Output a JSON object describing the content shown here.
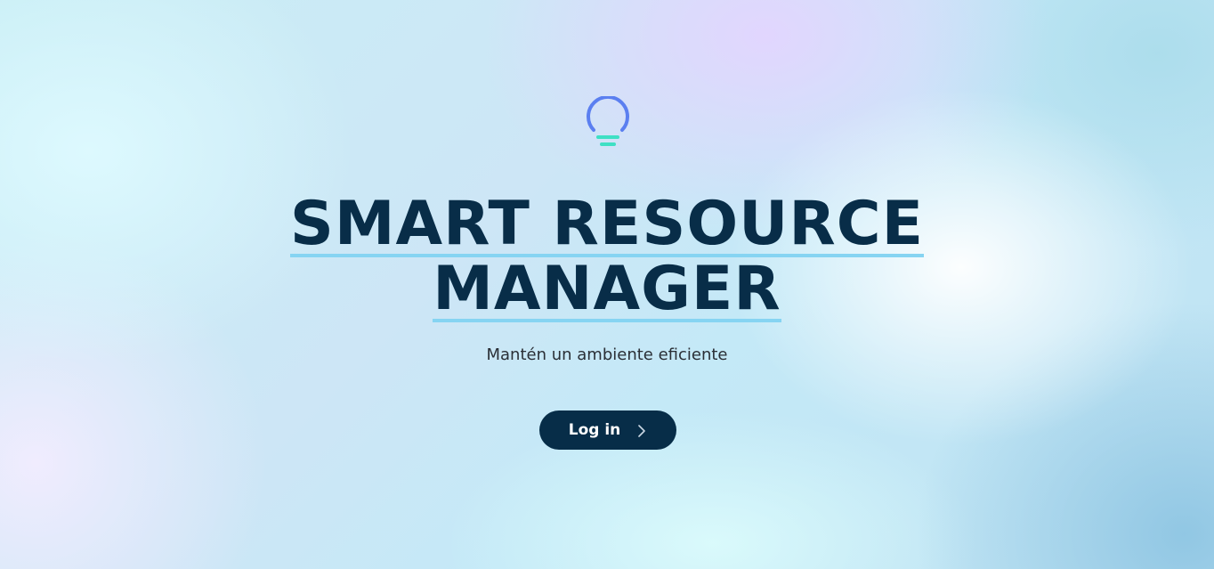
{
  "hero": {
    "logo_icon": "lightbulb-icon",
    "title_line1": "SMART RESOURCE",
    "title_line2": "MANAGER",
    "subtitle": "Mantén un ambiente eficiente"
  },
  "actions": {
    "login_label": "Log in",
    "login_icon": "chevron-right-icon"
  },
  "colors": {
    "title": "#082d48",
    "underline": "#86d4f2",
    "button_bg": "#072d48",
    "logo_ring": "#5b7ff0",
    "logo_base": "#3ee0c4"
  }
}
